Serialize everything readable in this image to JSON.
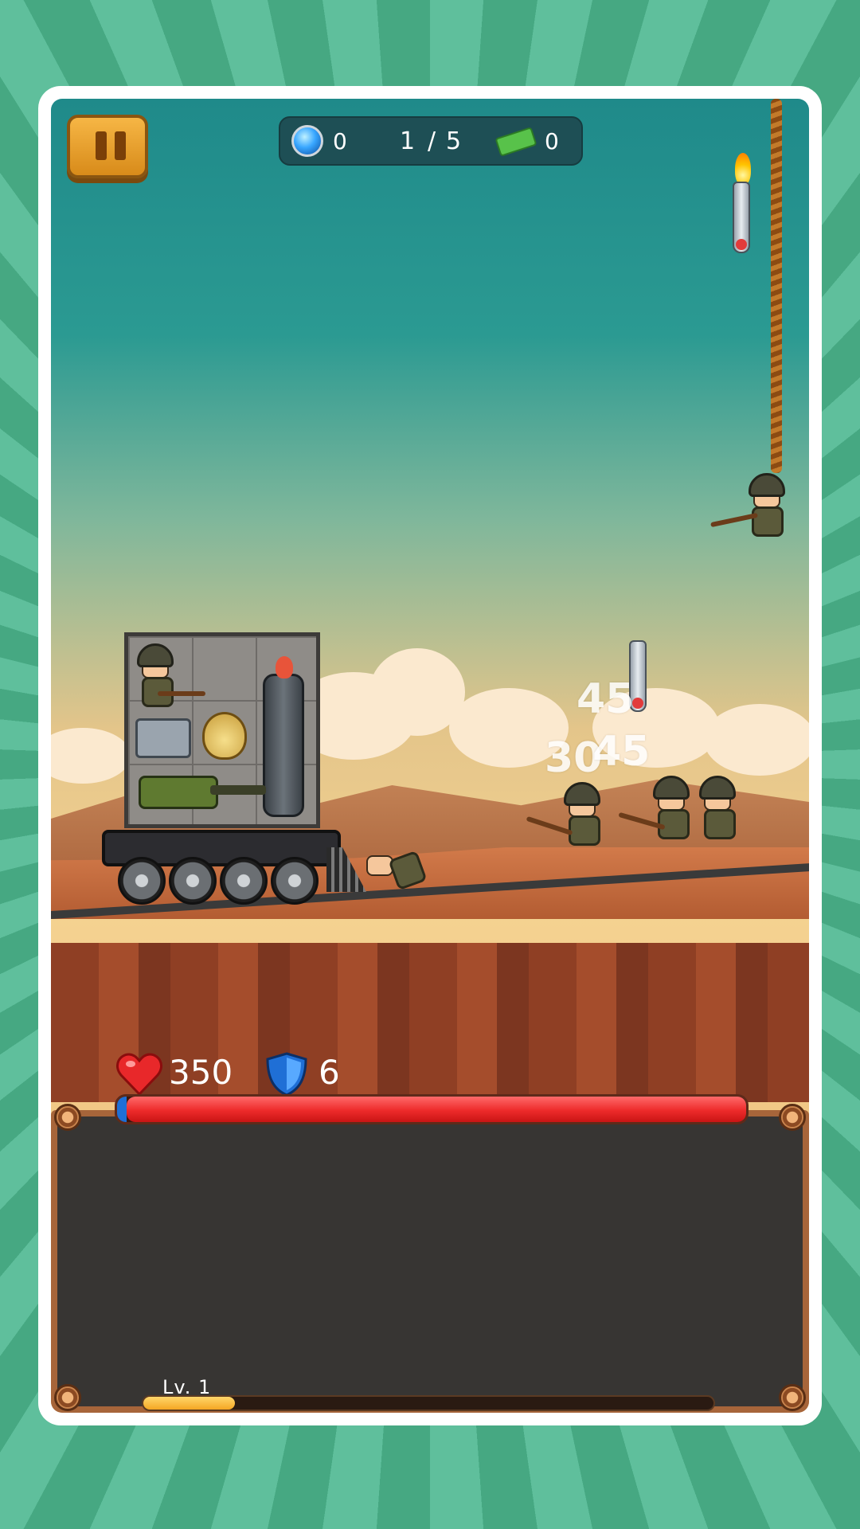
{
  "hud": {
    "gems": "0",
    "wave_current": "1",
    "wave_separator": "/",
    "wave_total": "5",
    "cash": "0",
    "pause_icon": "pause-icon"
  },
  "battle": {
    "damage_numbers": [
      "45",
      "30",
      "45"
    ]
  },
  "player": {
    "hp": "350",
    "shield": "6",
    "hp_fraction": 0.985,
    "shield_fraction": 0.015
  },
  "progress": {
    "level_label": "Lv. 1",
    "xp_fraction": 0.16
  },
  "colors": {
    "hp_bar": "#ed2a2a",
    "shield": "#1f6fd6",
    "xp_bar": "#f5a623",
    "panel": "#373533",
    "frame": "#a7653a"
  }
}
